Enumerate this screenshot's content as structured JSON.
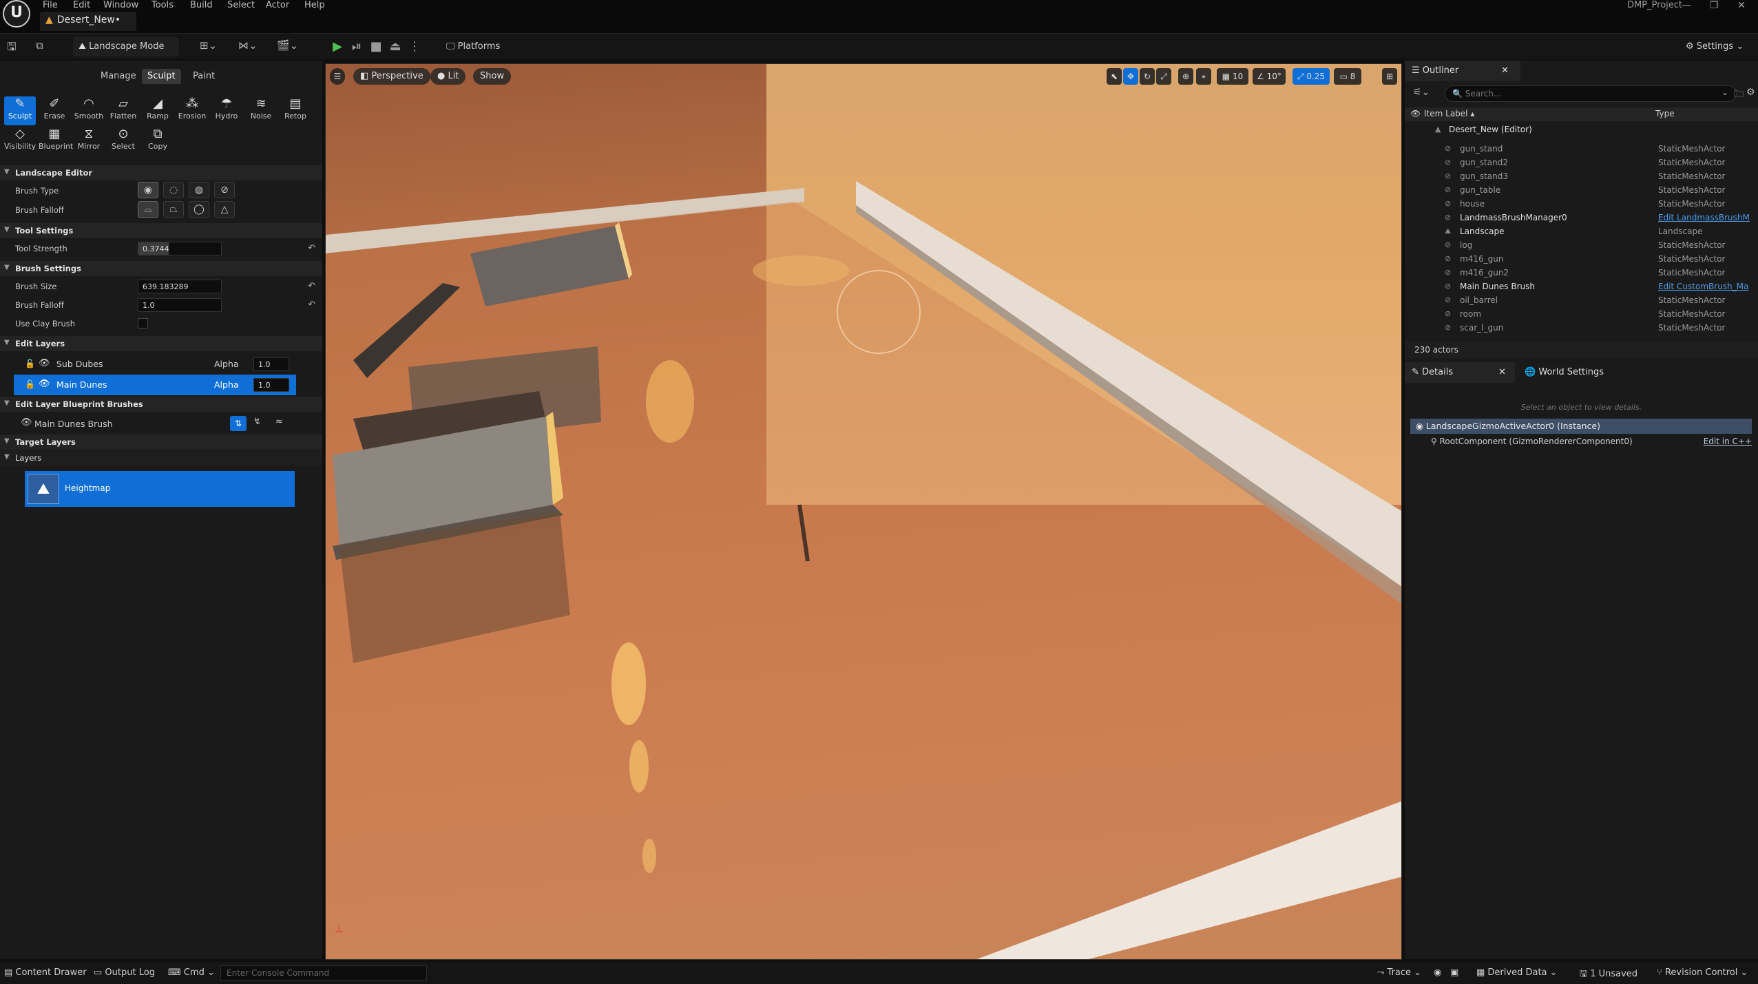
{
  "menu": [
    "File",
    "Edit",
    "Window",
    "Tools",
    "Build",
    "Select",
    "Actor",
    "Help"
  ],
  "window": {
    "level_tab": "Desert_New•",
    "project": "DMP_Project"
  },
  "toolbar": {
    "mode": "Landscape Mode",
    "platforms": "Platforms",
    "settings": "Settings"
  },
  "mode_tabs": [
    "Manage",
    "Sculpt",
    "Paint"
  ],
  "tools_row1": [
    "Sculpt",
    "Erase",
    "Smooth",
    "Flatten",
    "Ramp",
    "Erosion",
    "Hydro",
    "Noise",
    "Retop"
  ],
  "tools_row2": [
    "Visibility",
    "Blueprint",
    "Mirror",
    "Select",
    "Copy"
  ],
  "landscape_editor": {
    "title": "Landscape Editor",
    "brush_type_label": "Brush Type",
    "brush_falloff_label": "Brush Falloff"
  },
  "tool_settings": {
    "title": "Tool Settings",
    "tool_strength_label": "Tool Strength",
    "tool_strength": "0.3744"
  },
  "brush_settings": {
    "title": "Brush Settings",
    "brush_size_label": "Brush Size",
    "brush_size": "639.183289",
    "brush_falloff_label": "Brush Falloff",
    "brush_falloff": "1.0",
    "use_clay_label": "Use Clay Brush"
  },
  "edit_layers": {
    "title": "Edit Layers",
    "items": [
      {
        "name": "Sub Dubes",
        "alpha_label": "Alpha",
        "alpha": "1.0"
      },
      {
        "name": "Main Dunes",
        "alpha_label": "Alpha",
        "alpha": "1.0"
      }
    ]
  },
  "blueprint_brushes": {
    "title": "Edit Layer Blueprint Brushes",
    "item": "Main Dunes Brush"
  },
  "target_layers": {
    "title": "Target Layers",
    "layers_label": "Layers",
    "heightmap": "Heightmap"
  },
  "viewport": {
    "perspective": "Perspective",
    "lit": "Lit",
    "show": "Show",
    "grid": "10",
    "angle": "10°",
    "scale": "0.25",
    "camera": "8"
  },
  "outliner": {
    "tab": "Outliner",
    "search_placeholder": "Search...",
    "col_label": "Item Label ▴",
    "col_type": "Type",
    "root": "Desert_New (Editor)",
    "rows": [
      {
        "name": "gun_stand",
        "type": "StaticMeshActor"
      },
      {
        "name": "gun_stand2",
        "type": "StaticMeshActor"
      },
      {
        "name": "gun_stand3",
        "type": "StaticMeshActor"
      },
      {
        "name": "gun_table",
        "type": "StaticMeshActor"
      },
      {
        "name": "house",
        "type": "StaticMeshActor"
      },
      {
        "name": "LandmassBrushManager0",
        "type": "Edit LandmassBrushM"
      },
      {
        "name": "Landscape",
        "type": "Landscape"
      },
      {
        "name": "log",
        "type": "StaticMeshActor"
      },
      {
        "name": "m416_gun",
        "type": "StaticMeshActor"
      },
      {
        "name": "m416_gun2",
        "type": "StaticMeshActor"
      },
      {
        "name": "Main Dunes Brush",
        "type": "Edit CustomBrush_Ma"
      },
      {
        "name": "oil_barrel",
        "type": "StaticMeshActor"
      },
      {
        "name": "room",
        "type": "StaticMeshActor"
      },
      {
        "name": "scar_l_gun",
        "type": "StaticMeshActor"
      }
    ],
    "count": "230 actors"
  },
  "details": {
    "tab": "Details",
    "world_tab": "World Settings",
    "hint": "Select an object to view details.",
    "selected": "LandscapeGizmoActiveActor0 (Instance)",
    "component": "RootComponent (GizmoRendererComponent0)",
    "edit_cpp": "Edit in C++"
  },
  "status": {
    "content_drawer": "Content Drawer",
    "output_log": "Output Log",
    "cmd": "Cmd",
    "console_placeholder": "Enter Console Command",
    "trace": "Trace",
    "derived": "Derived Data",
    "unsaved": "1 Unsaved",
    "revision": "Revision Control"
  }
}
